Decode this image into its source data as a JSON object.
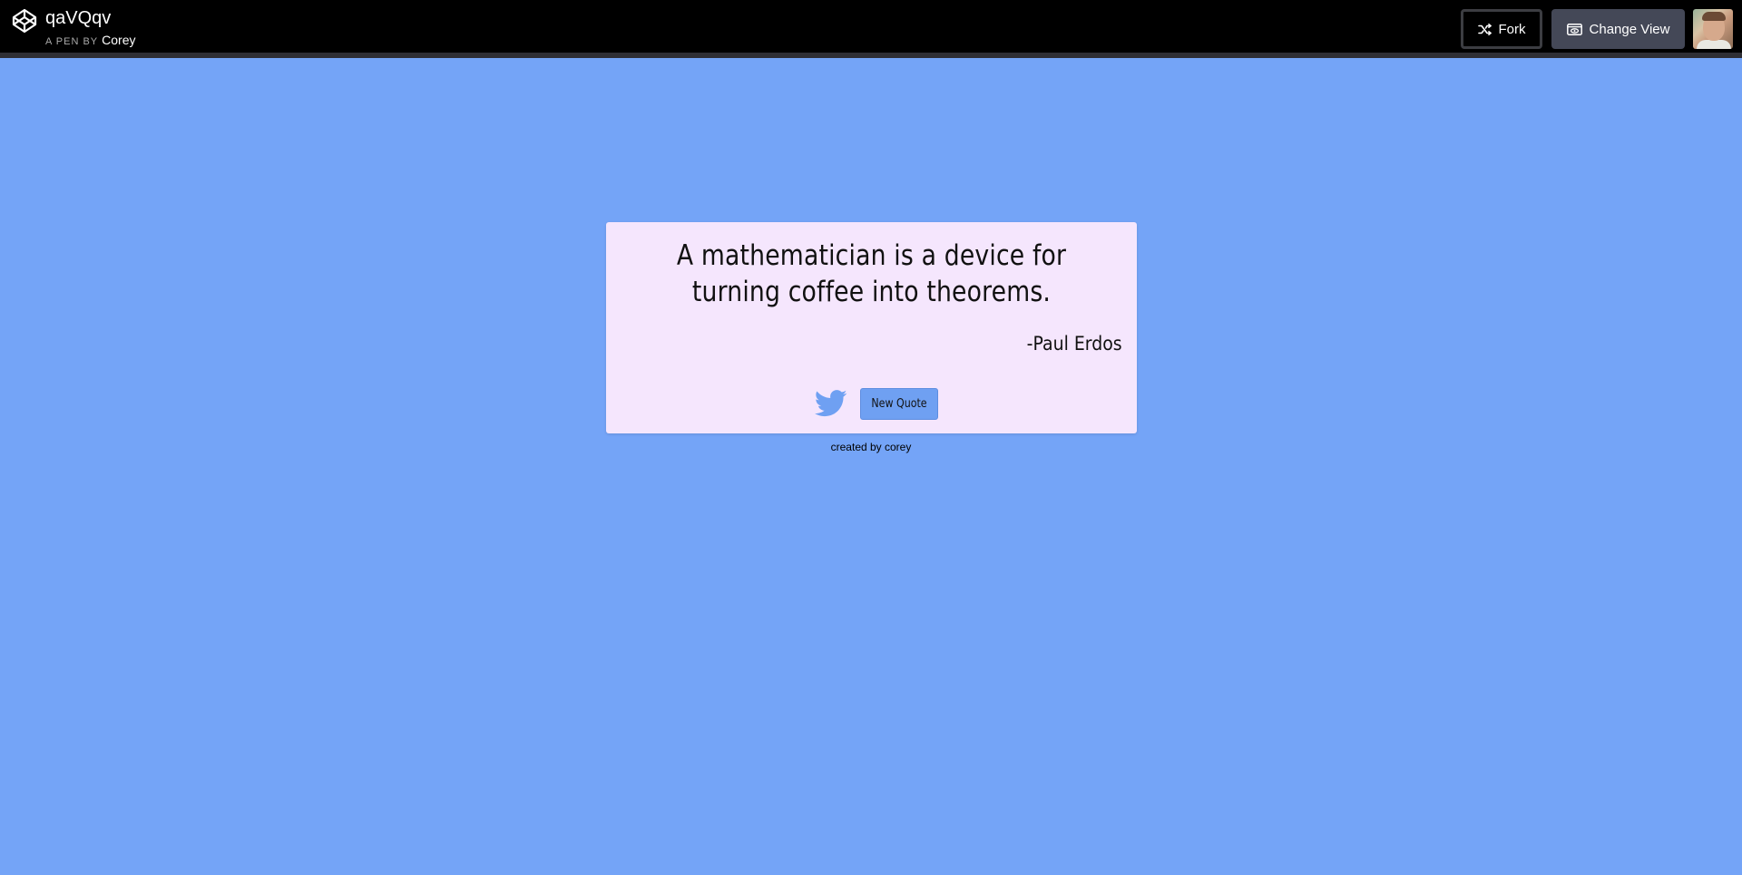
{
  "header": {
    "pen_title": "qaVQqv",
    "by_label": "A PEN BY",
    "author": "Corey",
    "fork_label": "Fork",
    "change_view_label": "Change View",
    "icons": {
      "logo": "codepen-logo-icon",
      "fork": "fork-icon",
      "change_view": "eye-window-icon",
      "avatar": "user-avatar"
    }
  },
  "quote": {
    "text": "A mathematician is a device for turning coffee into theorems.",
    "author": "-Paul Erdos",
    "new_quote_label": "New Quote",
    "tweet_icon": "twitter-icon"
  },
  "footer": {
    "credit": "created by corey"
  },
  "colors": {
    "page_background": "#74a4f7",
    "card_background": "#f5e6fd",
    "button_background": "#6fa0f2",
    "header_background": "#000000",
    "twitter_icon": "#6fa0f2"
  }
}
